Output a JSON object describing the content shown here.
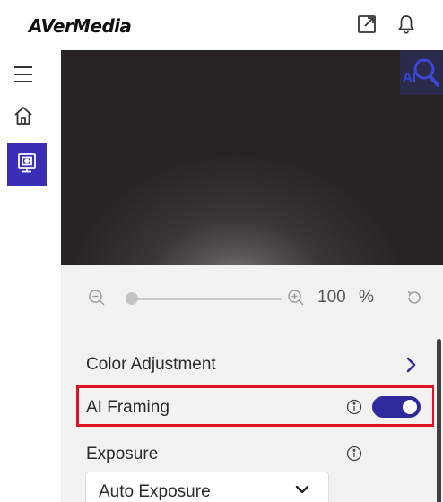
{
  "header": {
    "logo_text": "AVerMedia",
    "icons": [
      "external-window-icon",
      "bell-icon"
    ]
  },
  "sidebar": {
    "items": [
      {
        "icon": "hamburger-menu-icon",
        "active": false
      },
      {
        "icon": "home-icon",
        "active": false
      },
      {
        "icon": "camera-monitor-icon",
        "active": true
      }
    ],
    "active_color": "#3a2db6"
  },
  "preview": {
    "badge_text": "AI",
    "badge_icon": "ai-search-icon"
  },
  "zoom": {
    "value": "100",
    "unit": "%",
    "slider_level": 0,
    "icons": [
      "zoom-out-icon",
      "zoom-in-icon",
      "reset-icon"
    ]
  },
  "settings": {
    "color_adjustment_label": "Color Adjustment",
    "ai_framing_label": "AI Framing",
    "ai_framing_enabled": true,
    "exposure_label": "Exposure",
    "exposure_mode": "Auto Exposure",
    "toggle_color": "#2f2a9c",
    "highlight_color": "#e0141e"
  }
}
